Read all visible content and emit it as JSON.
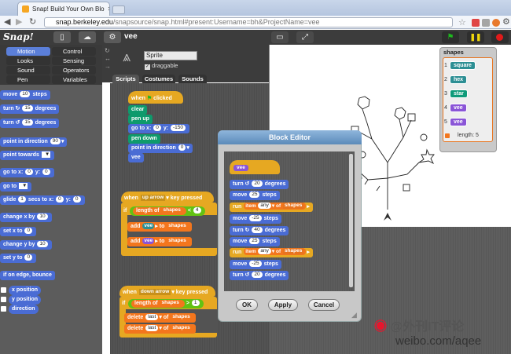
{
  "browser": {
    "tab_title": "Snap! Build Your Own Blo",
    "url_host": "snap.berkeley.edu",
    "url_path": "/snapsource/snap.html#present:Username=bh&ProjectName=vee"
  },
  "snap": {
    "logo": "Snap!",
    "project_name": "vee",
    "categories": [
      "Motion",
      "Looks",
      "Sound",
      "Pen",
      "Control",
      "Sensing",
      "Operators",
      "Variables"
    ],
    "palette": {
      "move": "move",
      "move_steps": "10",
      "steps": "steps",
      "turn": "turn",
      "turn_deg": "15",
      "degrees": "degrees",
      "point_in_direction": "point in direction",
      "dir_val": "90",
      "point_towards": "point towards",
      "goto_x": "go to x:",
      "x0": "0",
      "y_label": "y:",
      "y0": "0",
      "go_to": "go to",
      "glide": "glide",
      "glide_val": "1",
      "secs_to_x": "secs to x:",
      "change_x": "change x by",
      "cx_val": "10",
      "set_x": "set x to",
      "sx_val": "0",
      "change_y": "change y by",
      "cy_val": "10",
      "set_y": "set y to",
      "sy_val": "0",
      "bounce": "if on edge, bounce",
      "x_position": "x position",
      "y_position": "y position",
      "direction": "direction"
    },
    "sprite": {
      "name": "Sprite",
      "draggable_label": "draggable"
    },
    "tabs": [
      "Scripts",
      "Costumes",
      "Sounds"
    ],
    "script1": {
      "when": "when",
      "clicked": "clicked",
      "clear": "clear",
      "pen_up": "pen up",
      "goto": "go to x:",
      "x": "0",
      "y_label": "y:",
      "y": "-150",
      "pen_down": "pen down",
      "point": "point in direction",
      "dir": "0",
      "vee": "vee"
    },
    "script2": {
      "when": "when",
      "key": "up arrow",
      "key_pressed": "key pressed",
      "if": "if",
      "length_of": "length of",
      "shapes": "shapes",
      "lt": "<",
      "num": "4",
      "add": "add",
      "vee": "vee",
      "to": "to"
    },
    "script3": {
      "when": "when",
      "key": "down arrow",
      "key_pressed": "key pressed",
      "if": "if",
      "length_of": "length of",
      "shapes": "shapes",
      "gt": ">",
      "num": "1",
      "delete": "delete",
      "last": "last",
      "of": "of"
    },
    "watcher": {
      "title": "shapes",
      "items": [
        {
          "index": "1",
          "value": "square"
        },
        {
          "index": "2",
          "value": "hex"
        },
        {
          "index": "3",
          "value": "star"
        },
        {
          "index": "4",
          "value": "vee"
        },
        {
          "index": "5",
          "value": "vee"
        }
      ],
      "length_label": "length: 5"
    },
    "block_editor": {
      "title": "Block Editor",
      "hat": "vee",
      "turn": "turn",
      "turn1": "20",
      "degrees": "degrees",
      "move": "move",
      "m1": "25",
      "steps": "steps",
      "run": "run",
      "item": "item",
      "any": "any",
      "of": "of",
      "shapes": "shapes",
      "m2": "-25",
      "turn2": "40",
      "m3": "25",
      "m4": "-25",
      "turn3": "20",
      "ok": "OK",
      "apply": "Apply",
      "cancel": "Cancel"
    }
  },
  "watermark": {
    "line1": "@外刊IT评论",
    "line2": "weibo.com/aqee"
  }
}
